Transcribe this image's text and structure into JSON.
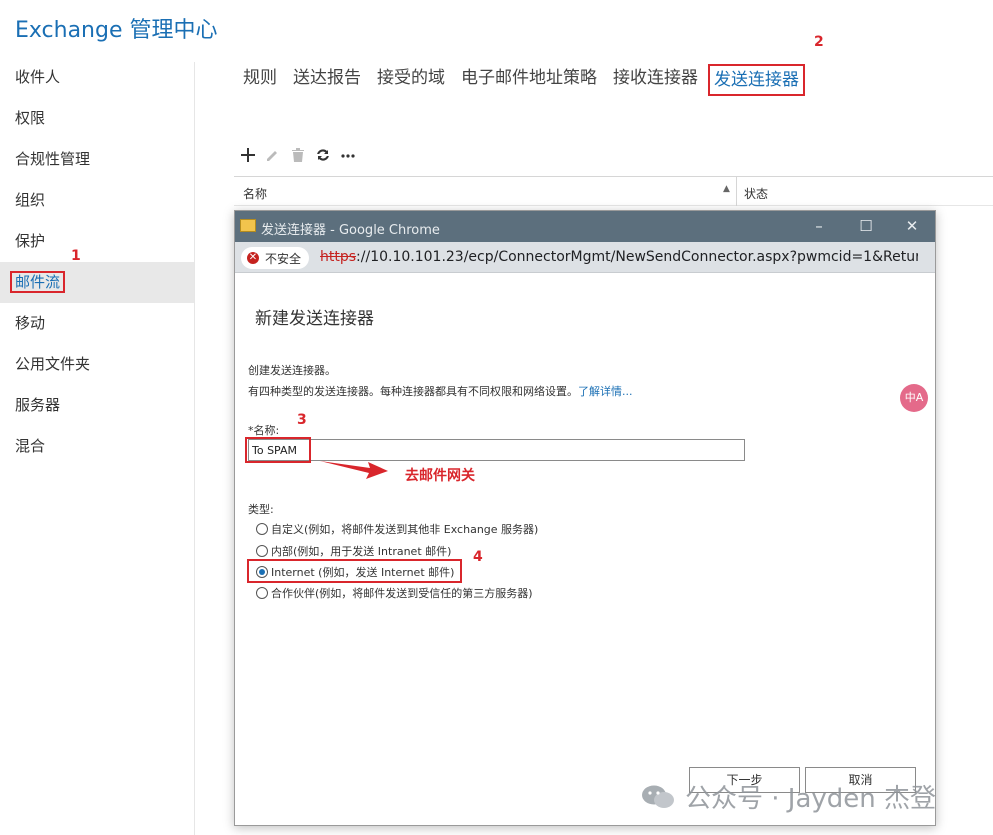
{
  "app": {
    "title": "Exchange 管理中心"
  },
  "nav": {
    "items": [
      {
        "label": "收件人"
      },
      {
        "label": "权限"
      },
      {
        "label": "合规性管理"
      },
      {
        "label": "组织"
      },
      {
        "label": "保护"
      },
      {
        "label": "邮件流",
        "active": true
      },
      {
        "label": "移动"
      },
      {
        "label": "公用文件夹"
      },
      {
        "label": "服务器"
      },
      {
        "label": "混合"
      }
    ]
  },
  "tabs": [
    {
      "label": "规则"
    },
    {
      "label": "送达报告"
    },
    {
      "label": "接受的域"
    },
    {
      "label": "电子邮件地址策略"
    },
    {
      "label": "接收连接器"
    },
    {
      "label": "发送连接器",
      "active": true
    }
  ],
  "toolbar": {
    "icons": [
      "plus-icon",
      "pencil-icon",
      "trash-icon",
      "refresh-icon",
      "more-icon"
    ],
    "more_label": "•••"
  },
  "list": {
    "columns": [
      {
        "label": "名称"
      },
      {
        "label": "状态"
      }
    ]
  },
  "popup": {
    "window_title": "发送连接器 - Google Chrome",
    "security_label": "不安全",
    "url_protocol": "https",
    "url_rest": "://10.10.101.23/ecp/ConnectorMgmt/NewSendConnector.aspx?pwmcid=1&Retur...",
    "heading": "新建发送连接器",
    "desc1": "创建发送连接器。",
    "desc2": "有四种类型的发送连接器。每种连接器都具有不同权限和网络设置。",
    "learn_more": "了解详情...",
    "name_label": "*名称:",
    "name_value": "To SPAM",
    "type_label": "类型:",
    "types": [
      {
        "label": "自定义(例如，将邮件发送到其他非 Exchange 服务器)",
        "checked": false
      },
      {
        "label": "内部(例如，用于发送 Intranet 邮件)",
        "checked": false
      },
      {
        "label": "Internet (例如，发送 Internet 邮件)",
        "checked": true
      },
      {
        "label": "合作伙伴(例如，将邮件发送到受信任的第三方服务器)",
        "checked": false
      }
    ],
    "next_button": "下一步",
    "cancel_button": "取消",
    "translate_label": "中A"
  },
  "annotations": {
    "step1": "1",
    "step2": "2",
    "step3": "3",
    "step4": "4",
    "note": "去邮件网关",
    "color": "#d9262c"
  },
  "watermark": {
    "text": "公众号 · Jayden 杰登"
  },
  "colors": {
    "accent": "#1a6fb4",
    "titlebar": "#5c6f7d",
    "highlight": "#d9262c"
  }
}
